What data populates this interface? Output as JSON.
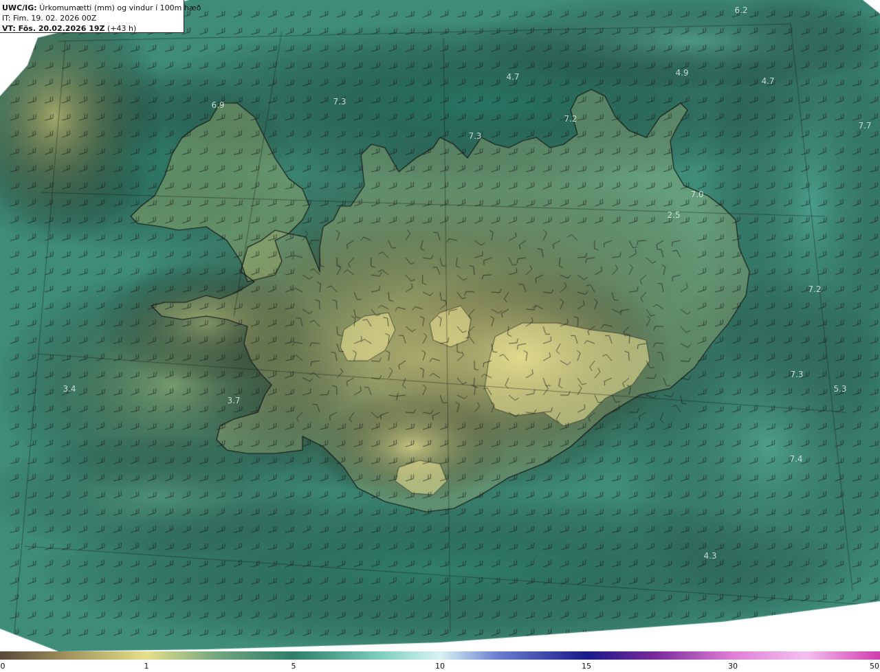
{
  "header": {
    "product": "UWC/IG:",
    "title": "Úrkomumætti (mm) og vindur í 100m hæð",
    "init_label": "IT: Fim. 19. 02. 2026 00Z",
    "valid_label": "VT: Fös. 20.02.2026 19Z",
    "lead_label": "(+43 h)"
  },
  "colorbar": {
    "ticks": [
      {
        "label": "0",
        "value": 0
      },
      {
        "label": "1",
        "value": 1
      },
      {
        "label": "5",
        "value": 5
      },
      {
        "label": "10",
        "value": 10
      },
      {
        "label": "15",
        "value": 15
      },
      {
        "label": "30",
        "value": 30
      },
      {
        "label": "50",
        "value": 50
      }
    ],
    "stops": [
      {
        "value": 0,
        "color": "#5a4a3a"
      },
      {
        "value": 0.5,
        "color": "#a89a62"
      },
      {
        "value": 1,
        "color": "#e6e08a"
      },
      {
        "value": 3,
        "color": "#6fa57f"
      },
      {
        "value": 5,
        "color": "#2f7e6a"
      },
      {
        "value": 8,
        "color": "#7fd0c0"
      },
      {
        "value": 10,
        "color": "#d8f4f4"
      },
      {
        "value": 12,
        "color": "#6a7fd0"
      },
      {
        "value": 15,
        "color": "#1a1a8a"
      },
      {
        "value": 22,
        "color": "#7a2a9a"
      },
      {
        "value": 30,
        "color": "#e080d8"
      },
      {
        "value": 40,
        "color": "#f4c0ee"
      },
      {
        "value": 50,
        "color": "#d040b0"
      }
    ]
  },
  "value_labels": [
    {
      "text": "6.2",
      "value": 6.2
    },
    {
      "text": "4.7",
      "value": 4.7
    },
    {
      "text": "4.9",
      "value": 4.9
    },
    {
      "text": "4.7",
      "value": 4.7
    },
    {
      "text": "6.9",
      "value": 6.9
    },
    {
      "text": "7.3",
      "value": 7.3
    },
    {
      "text": "7.2",
      "value": 7.2
    },
    {
      "text": "7.3",
      "value": 7.3
    },
    {
      "text": "7.7",
      "value": 7.7
    },
    {
      "text": "7.0",
      "value": 7.0
    },
    {
      "text": "2.5",
      "value": 2.5
    },
    {
      "text": "7.2",
      "value": 7.2
    },
    {
      "text": "3.4",
      "value": 3.4
    },
    {
      "text": "3.7",
      "value": 3.7
    },
    {
      "text": "7.3",
      "value": 7.3
    },
    {
      "text": "5.3",
      "value": 5.3
    },
    {
      "text": "7.4",
      "value": 7.4
    },
    {
      "text": "4.3",
      "value": 4.3
    }
  ]
}
